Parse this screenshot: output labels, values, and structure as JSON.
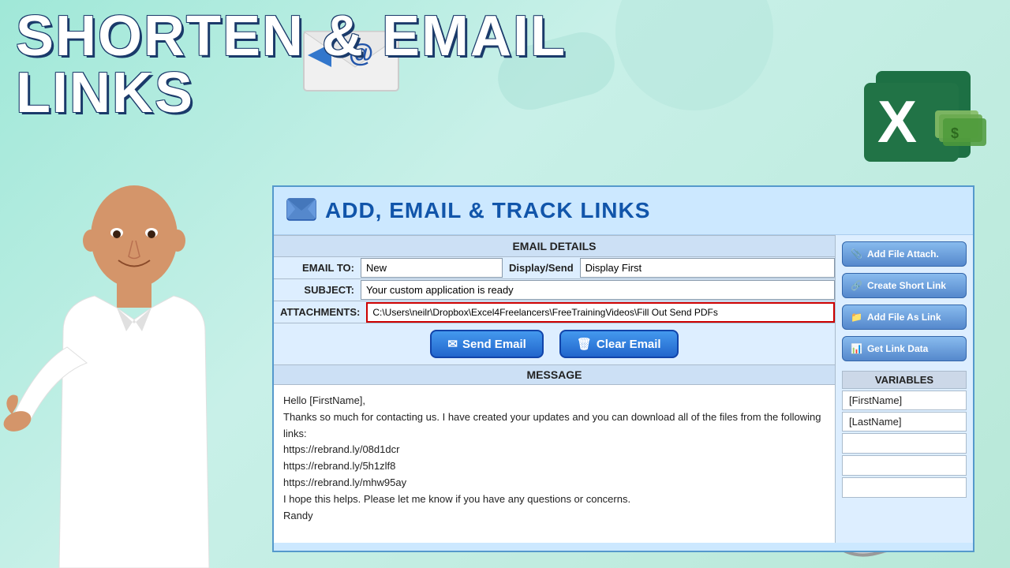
{
  "title": {
    "line1": "SHORTEN & EMAIL",
    "line2": "LINKS"
  },
  "panel": {
    "header_title": "ADD, EMAIL & TRACK LINKS",
    "email_details_header": "EMAIL DETAILS",
    "email_to_label": "EMAIL TO:",
    "email_to_value": "New",
    "display_send_label": "Display/Send",
    "display_send_value": "Display First",
    "subject_label": "SUBJECT:",
    "subject_value": "Your custom application is ready",
    "attachments_label": "ATTACHMENTS:",
    "attachments_value": "C:\\Users\\neilr\\Dropbox\\Excel4Freelancers\\FreeTrainingVideos\\Fill Out Send PDFs",
    "send_email_btn": "Send Email",
    "clear_email_btn": "Clear Email",
    "message_header": "MESSAGE",
    "message_body_lines": [
      "Hello [FirstName],",
      "Thanks so much for contacting us. I have created your updates and you can download all of the files from the following links:",
      "https://rebrand.ly/08d1dcr",
      "https://rebrand.ly/5h1zlf8",
      "https://rebrand.ly/mhw95ay",
      "I hope this helps. Please let me know if you have any questions or concerns.",
      "Randy"
    ]
  },
  "sidebar": {
    "btn_add_file": "Add File Attach.",
    "btn_create_short": "Create Short Link",
    "btn_add_file_link": "Add File As Link",
    "btn_get_link_data": "Get Link Data",
    "variables_header": "VARIABLES",
    "variables": [
      "[FirstName]",
      "[LastName]"
    ]
  }
}
